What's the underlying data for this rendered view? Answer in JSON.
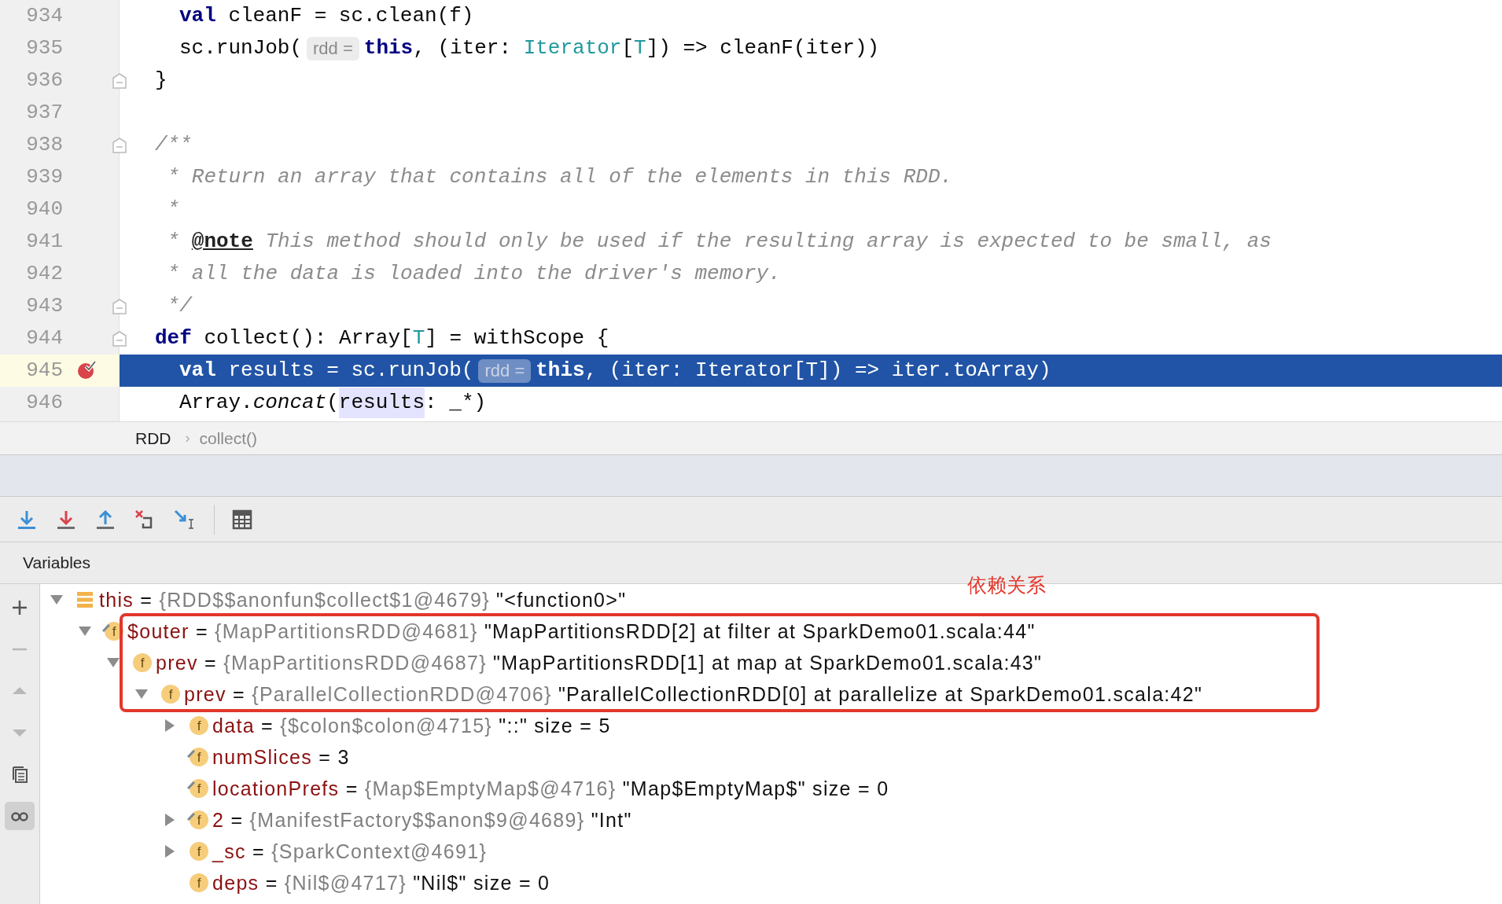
{
  "editor": {
    "lines": [
      {
        "number": "934",
        "fold": false,
        "breakpoint": false,
        "current": false,
        "indented": true,
        "tokens": [
          {
            "kind": "keyword",
            "text": "val"
          },
          {
            "kind": "plain",
            "text": " cleanF = sc.clean(f)"
          }
        ]
      },
      {
        "number": "935",
        "fold": false,
        "breakpoint": false,
        "current": false,
        "indented": true,
        "tokens": [
          {
            "kind": "plain",
            "text": "sc.runJob("
          },
          {
            "kind": "hint",
            "text": "rdd ="
          },
          {
            "kind": "keyword",
            "text": "this"
          },
          {
            "kind": "plain",
            "text": ", (iter: "
          },
          {
            "kind": "type",
            "text": "Iterator"
          },
          {
            "kind": "plain",
            "text": "["
          },
          {
            "kind": "type",
            "text": "T"
          },
          {
            "kind": "plain",
            "text": "]) => cleanF(iter))"
          }
        ]
      },
      {
        "number": "936",
        "fold": true,
        "breakpoint": false,
        "current": false,
        "indented": false,
        "tokens": [
          {
            "kind": "plain",
            "text": "}"
          }
        ]
      },
      {
        "number": "937",
        "fold": false,
        "breakpoint": false,
        "current": false
      },
      {
        "number": "938",
        "fold": true,
        "breakpoint": false,
        "current": false,
        "indented": false,
        "tokens": [
          {
            "kind": "comment",
            "text": "/**"
          }
        ]
      },
      {
        "number": "939",
        "fold": false,
        "breakpoint": false,
        "current": false,
        "indented": false,
        "tokens": [
          {
            "kind": "comment",
            "text": " * Return an array that contains all of the elements in this RDD."
          }
        ]
      },
      {
        "number": "940",
        "fold": false,
        "breakpoint": false,
        "current": false,
        "indented": false,
        "tokens": [
          {
            "kind": "comment",
            "text": " *"
          }
        ]
      },
      {
        "number": "941",
        "fold": false,
        "breakpoint": false,
        "current": false,
        "indented": false,
        "tokens": [
          {
            "kind": "comment",
            "text": " * "
          },
          {
            "kind": "doc_tag",
            "text": "@note"
          },
          {
            "kind": "comment",
            "text": " This method should only be used if the resulting array is expected to be small, as"
          }
        ]
      },
      {
        "number": "942",
        "fold": false,
        "breakpoint": false,
        "current": false,
        "indented": false,
        "tokens": [
          {
            "kind": "comment",
            "text": " * all the data is loaded into the driver's memory."
          }
        ]
      },
      {
        "number": "943",
        "fold": true,
        "breakpoint": false,
        "current": false,
        "indented": false,
        "tokens": [
          {
            "kind": "comment",
            "text": " */"
          }
        ]
      },
      {
        "number": "944",
        "fold": true,
        "breakpoint": false,
        "current": false,
        "indented": false,
        "tokens": [
          {
            "kind": "keyword",
            "text": "def"
          },
          {
            "kind": "plain",
            "text": " collect(): Array["
          },
          {
            "kind": "type",
            "text": "T"
          },
          {
            "kind": "plain",
            "text": "] = withScope {"
          }
        ]
      },
      {
        "number": "945",
        "fold": false,
        "breakpoint": true,
        "current": true,
        "indented": true,
        "tokens": [
          {
            "kind": "keyword",
            "text": "val"
          },
          {
            "kind": "plain",
            "text": " results = sc.runJob("
          },
          {
            "kind": "hint",
            "text": "rdd ="
          },
          {
            "kind": "keyword",
            "text": "this"
          },
          {
            "kind": "plain",
            "text": ", (iter: Iterator[T]) => iter.toArray)"
          }
        ]
      },
      {
        "number": "946",
        "fold": false,
        "breakpoint": false,
        "current": false,
        "indented": true,
        "tokens": [
          {
            "kind": "plain",
            "text": "Array."
          },
          {
            "kind": "italic",
            "text": "concat"
          },
          {
            "kind": "plain",
            "text": "("
          },
          {
            "kind": "usage",
            "text": "results"
          },
          {
            "kind": "plain",
            "text": ": _*)"
          }
        ]
      }
    ]
  },
  "breadcrumb": [
    {
      "label": "RDD"
    },
    {
      "label": "collect()"
    }
  ],
  "breadcrumb_separator": "›",
  "debugger": {
    "panel_title": "Variables",
    "side_toolbar": [
      {
        "kind": "add",
        "disabled": false,
        "selected": false
      },
      {
        "kind": "remove",
        "disabled": true,
        "selected": false
      },
      {
        "kind": "up",
        "disabled": true,
        "selected": false
      },
      {
        "kind": "down",
        "disabled": true,
        "selected": false
      },
      {
        "kind": "copy",
        "disabled": false,
        "selected": false
      },
      {
        "kind": "watches",
        "disabled": false,
        "selected": true
      }
    ],
    "variables": [
      {
        "kind": "object",
        "expanded": true,
        "final": false,
        "name": "this",
        "sep": "=",
        "ref": "{RDD$$anonfun$collect$1@4679}",
        "value": "\"<function0>\"",
        "children": [
          {
            "kind": "field",
            "badge": "f",
            "expanded": true,
            "final": true,
            "name": "$outer",
            "sep": "=",
            "ref": "{MapPartitionsRDD@4681}",
            "value": "\"MapPartitionsRDD[2] at filter at SparkDemo01.scala:44\"",
            "children": [
              {
                "kind": "field",
                "badge": "f",
                "expanded": true,
                "final": false,
                "name": "prev",
                "sep": "=",
                "ref": "{MapPartitionsRDD@4687}",
                "value": "\"MapPartitionsRDD[1] at map at SparkDemo01.scala:43\"",
                "children": [
                  {
                    "kind": "field",
                    "badge": "f",
                    "expanded": true,
                    "final": false,
                    "name": "prev",
                    "sep": "=",
                    "ref": "{ParallelCollectionRDD@4706}",
                    "value": "\"ParallelCollectionRDD[0] at parallelize at SparkDemo01.scala:42\"",
                    "children": [
                      {
                        "kind": "field",
                        "badge": "f",
                        "expanded": false,
                        "final": false,
                        "name": "data",
                        "sep": "=",
                        "ref": "{$colon$colon@4715}",
                        "value": "\"::\" size = 5"
                      },
                      {
                        "kind": "field",
                        "badge": "f",
                        "final": true,
                        "name": "numSlices",
                        "sep": "=",
                        "value": "3"
                      },
                      {
                        "kind": "field",
                        "badge": "f",
                        "final": true,
                        "name": "locationPrefs",
                        "sep": "=",
                        "ref": "{Map$EmptyMap$@4716}",
                        "value": "\"Map$EmptyMap$\" size = 0"
                      },
                      {
                        "kind": "field",
                        "badge": "f",
                        "expanded": false,
                        "final": true,
                        "name": "2",
                        "sep": "=",
                        "ref": "{ManifestFactory$$anon$9@4689}",
                        "value": "\"Int\""
                      },
                      {
                        "kind": "field",
                        "badge": "f",
                        "expanded": false,
                        "final": false,
                        "name": "_sc",
                        "sep": "=",
                        "ref": "{SparkContext@4691}"
                      },
                      {
                        "kind": "field",
                        "badge": "f",
                        "final": false,
                        "name": "deps",
                        "sep": "=",
                        "ref": "{Nil$@4717}",
                        "value": "\"Nil$\" size = 0"
                      }
                    ]
                  }
                ]
              }
            ]
          }
        ]
      }
    ]
  },
  "annotation": {
    "label": "依赖关系"
  }
}
